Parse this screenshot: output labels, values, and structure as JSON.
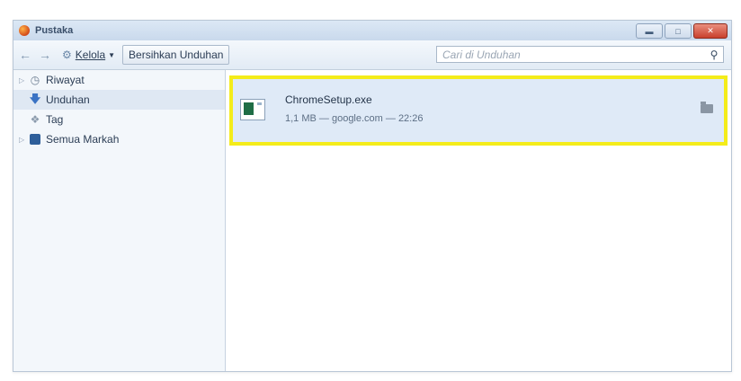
{
  "window": {
    "title": "Pustaka"
  },
  "titlebar": {
    "minimize_icon": "minimize-icon",
    "maximize_icon": "maximize-icon",
    "close_icon": "close-icon"
  },
  "toolbar": {
    "back_icon": "back-arrow-icon",
    "forward_icon": "forward-arrow-icon",
    "manage_label": "Kelola",
    "clear_downloads_label": "Bersihkan Unduhan"
  },
  "search": {
    "placeholder": "Cari di Unduhan",
    "value": ""
  },
  "sidebar": {
    "items": [
      {
        "label": "Riwayat",
        "icon": "history-icon",
        "expandable": true,
        "selected": false
      },
      {
        "label": "Unduhan",
        "icon": "download-icon",
        "expandable": false,
        "selected": true
      },
      {
        "label": "Tag",
        "icon": "tag-icon",
        "expandable": false,
        "selected": false
      },
      {
        "label": "Semua Markah",
        "icon": "bookmarks-icon",
        "expandable": true,
        "selected": false
      }
    ]
  },
  "downloads": [
    {
      "filename": "ChromeSetup.exe",
      "details": "1,1 MB — google.com — 22:26",
      "icon": "exe-file-icon",
      "action_icon": "folder-icon"
    }
  ],
  "colors": {
    "highlight_border": "#f4ec1a",
    "selected_row": "#dfeaf7",
    "window_bg": "#eef3f9"
  }
}
